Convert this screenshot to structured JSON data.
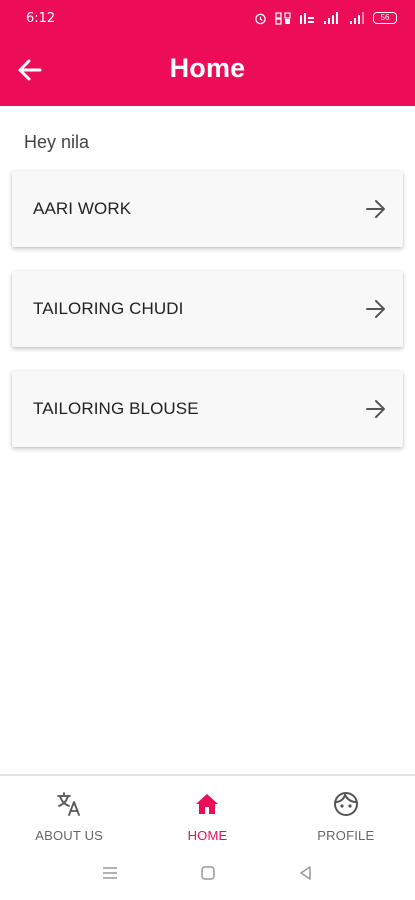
{
  "status_bar": {
    "time": "6:12",
    "icons": [
      "alarm-icon",
      "data-saver-icon",
      "volte-icon",
      "signal-icon",
      "signal-icon"
    ],
    "battery": "56"
  },
  "app_bar": {
    "title": "Home",
    "back_icon": "arrow-left-icon",
    "color": "#ec0c57"
  },
  "greeting": "Hey nila",
  "cards": [
    {
      "label": "AARI WORK",
      "icon": "arrow-right-icon"
    },
    {
      "label": "TAILORING CHUDI",
      "icon": "arrow-right-icon"
    },
    {
      "label": "TAILORING BLOUSE",
      "icon": "arrow-right-icon"
    }
  ],
  "bottom_nav": {
    "items": [
      {
        "label": "ABOUT US",
        "icon": "translate-icon",
        "active": false
      },
      {
        "label": "HOME",
        "icon": "home-icon",
        "active": true
      },
      {
        "label": "PROFILE",
        "icon": "face-icon",
        "active": false
      }
    ],
    "active_color": "#ec0c57",
    "inactive_color": "#666666"
  },
  "system_nav": {
    "buttons": [
      "menu-icon",
      "home-square-icon",
      "back-triangle-icon"
    ]
  }
}
